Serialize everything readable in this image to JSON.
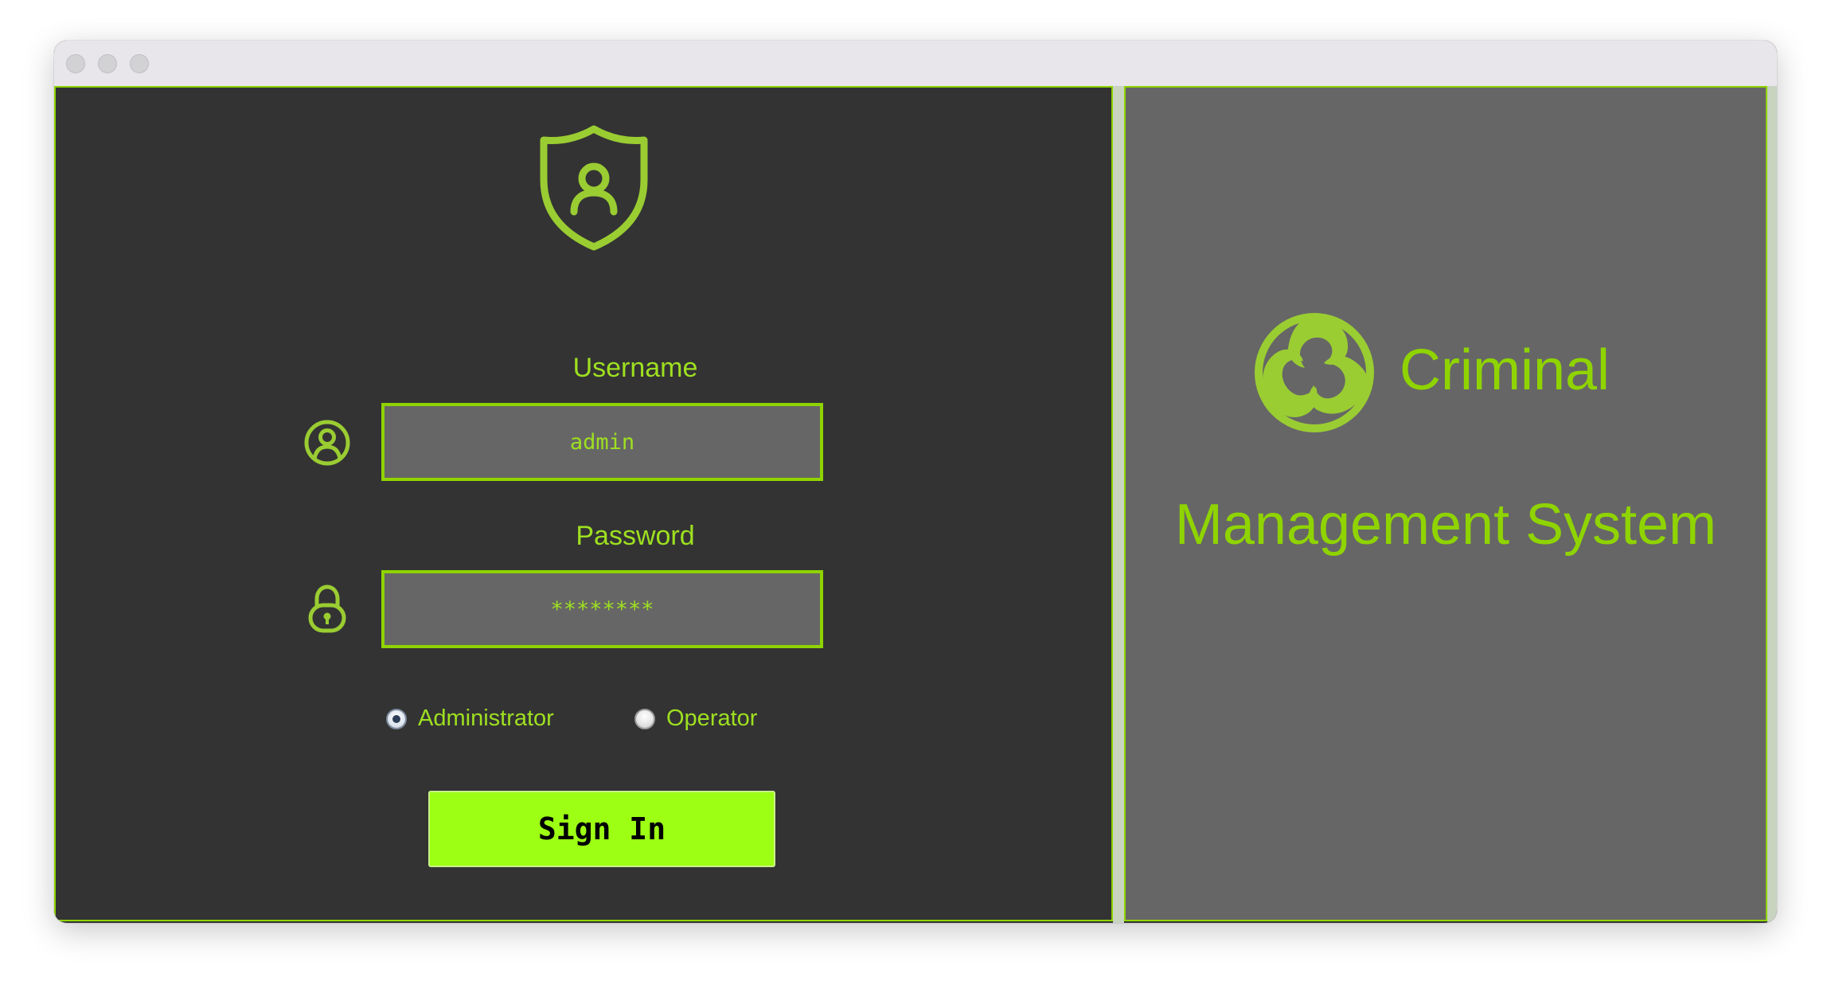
{
  "login": {
    "username_label": "Username",
    "username_value": "admin",
    "password_label": "Password",
    "password_value": "********",
    "roles": [
      {
        "label": "Administrator",
        "selected": true
      },
      {
        "label": "Operator",
        "selected": false
      }
    ],
    "signin_label": "Sign In"
  },
  "brand": {
    "line1": "Criminal",
    "line2": "Management System"
  },
  "icons": {
    "shield": "shield-user-icon",
    "user": "user-circle-icon",
    "lock": "padlock-icon",
    "logo": "triskelion-logo-icon"
  },
  "colors": {
    "accent": "#8fd400",
    "button": "#9dff14",
    "dark_panel": "#333333",
    "light_panel": "#666666"
  }
}
